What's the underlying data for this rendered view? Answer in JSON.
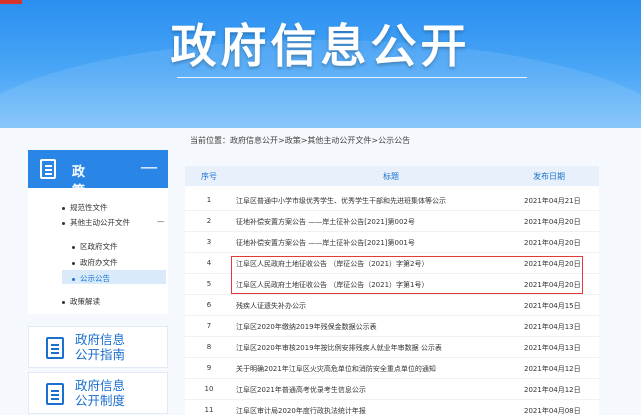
{
  "banner": {
    "title": "政府信息公开"
  },
  "breadcrumb": {
    "prefix": "当前位置：",
    "items": [
      "政府信息公开",
      "政策",
      "其他主动公开文件",
      "公示公告"
    ],
    "separator": ">"
  },
  "sidebar": {
    "header": {
      "label": "政 策",
      "toggle": "—"
    },
    "items": [
      {
        "label": "规范性文件"
      },
      {
        "label": "其他主动公开文件",
        "toggle": "—"
      },
      {
        "label": "区政府文件"
      },
      {
        "label": "政府办文件"
      },
      {
        "label": "公示公告"
      },
      {
        "label": "政策解读"
      }
    ],
    "cards": [
      {
        "line1": "政府信息",
        "line2": "公开指南"
      },
      {
        "line1": "政府信息",
        "line2": "公开制度"
      }
    ]
  },
  "table": {
    "headers": {
      "num": "序号",
      "title": "标题",
      "date": "发布日期"
    },
    "rows": [
      {
        "num": "1",
        "title": "江阜区普通中小学市级优秀学生、优秀学生干部和先进班集体等公示",
        "date": "2021年04月21日"
      },
      {
        "num": "2",
        "title": "征地补偿安置方案公告 ——岸土征补公告[2021]第002号",
        "date": "2021年04月20日"
      },
      {
        "num": "3",
        "title": "征地补偿安置方案公告 ——岸土征补公告[2021]第001号",
        "date": "2021年04月20日"
      },
      {
        "num": "4",
        "title": "江阜区人民政府土地征收公告 （岸征公告（2021）字第2号）",
        "date": "2021年04月20日"
      },
      {
        "num": "5",
        "title": "江阜区人民政府土地征收公告 （岸征公告（2021）字第1号）",
        "date": "2021年04月20日"
      },
      {
        "num": "6",
        "title": "残疾人证遗失补办公示",
        "date": "2021年04月15日"
      },
      {
        "num": "7",
        "title": "江阜区2020年缴纳2019年残保金数据公示表",
        "date": "2021年04月13日"
      },
      {
        "num": "8",
        "title": "江阜区2020年审核2019年按比例安排残疾人就业年审数据 公示表",
        "date": "2021年04月13日"
      },
      {
        "num": "9",
        "title": "关于明确2021年江阜区火灾高危单位和消防安全重点单位的通知",
        "date": "2021年04月12日"
      },
      {
        "num": "10",
        "title": "江阜区2021年普通高考优录考生信息公示",
        "date": "2021年04月12日"
      },
      {
        "num": "11",
        "title": "江阜区审计局2020年度行政执法统计年报",
        "date": "2021年04月08日"
      }
    ]
  }
}
